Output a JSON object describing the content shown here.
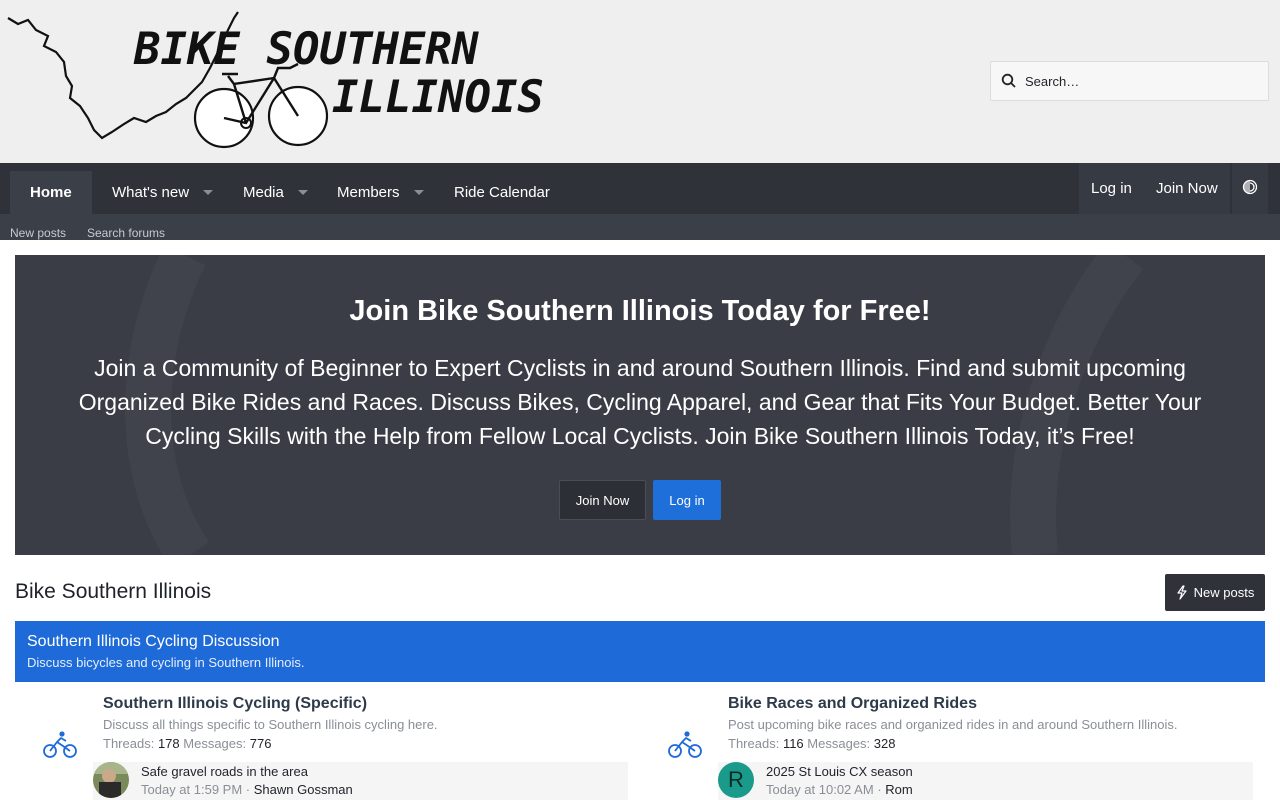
{
  "header": {
    "logo_line1": "BIKE SOUTHERN",
    "logo_line2": "ILLINOIS",
    "search_placeholder": "Search…"
  },
  "nav": {
    "tabs": [
      {
        "label": "Home",
        "active": true
      },
      {
        "label": "What's new"
      },
      {
        "label": "Media"
      },
      {
        "label": "Members"
      },
      {
        "label": "Ride Calendar"
      }
    ],
    "login": "Log in",
    "join": "Join Now",
    "subnav": [
      "New posts",
      "Search forums"
    ]
  },
  "hero": {
    "title": "Join Bike Southern Illinois Today for Free!",
    "text": "Join a Community of Beginner to Expert Cyclists in and around Southern Illinois. Find and submit upcoming Organized Bike Rides and Races. Discuss Bikes, Cycling Apparel, and Gear that Fits Your Budget. Better Your Cycling Skills with the Help from Fellow Local Cyclists. Join Bike Southern Illinois Today, it’s Free!",
    "join_button": "Join Now",
    "login_button": "Log in"
  },
  "page": {
    "title": "Bike Southern Illinois",
    "new_posts_button": "New posts"
  },
  "category": {
    "title": "Southern Illinois Cycling Discussion",
    "description": "Discuss bicycles and cycling in Southern Illinois."
  },
  "forums": [
    {
      "title": "Southern Illinois Cycling (Specific)",
      "description": "Discuss all things specific to Southern Illinois cycling here.",
      "threads_label": "Threads:",
      "threads": "178",
      "messages_label": "Messages:",
      "messages": "776",
      "last_post": {
        "title": "Safe gravel roads in the area",
        "time": "Today at 1:59 PM",
        "sep": "·",
        "user": "Shawn Gossman",
        "avatar_letter": ""
      }
    },
    {
      "title": "Bike Races and Organized Rides",
      "description": "Post upcoming bike races and organized rides in and around Southern Illinois.",
      "threads_label": "Threads:",
      "threads": "116",
      "messages_label": "Messages:",
      "messages": "328",
      "last_post": {
        "title": "2025 St Louis CX season",
        "time": "Today at 10:02 AM",
        "sep": "·",
        "user": "Rom",
        "avatar_letter": "R"
      }
    }
  ],
  "colors": {
    "accent": "#1d6ad8",
    "nav_bg": "#2f3239",
    "hero_bg": "#3a3d45",
    "header_bg": "#efefef"
  }
}
